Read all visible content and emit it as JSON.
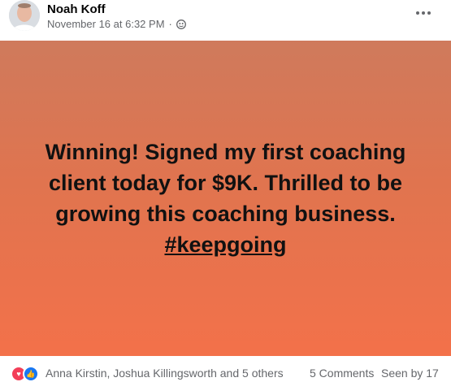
{
  "post": {
    "author_name": "Noah Koff",
    "timestamp": "November 16 at 6:32 PM",
    "separator": "·",
    "audience_icon": "group-icon",
    "text_lines": [
      "Winning! Signed my first coaching",
      "client today for $9K. Thrilled to be",
      "growing this coaching business."
    ],
    "hashtag": "#keepgoing",
    "background_colors": [
      "#cf7a5c",
      "#f3714a"
    ]
  },
  "reactions": {
    "icons": [
      "love-icon",
      "like-icon"
    ],
    "reactors_text": "Anna Kirstin, Joshua Killingsworth and 5 others",
    "comments_text": "5 Comments",
    "seen_by_text": "Seen by 17"
  }
}
